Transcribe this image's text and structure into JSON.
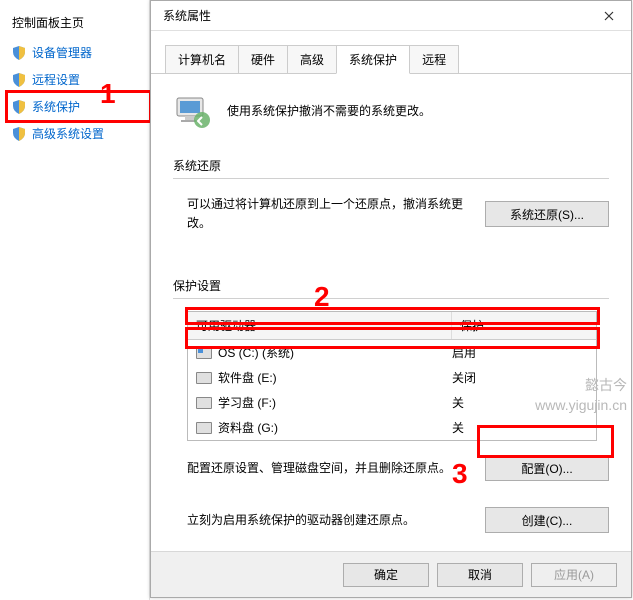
{
  "sidebar": {
    "title": "控制面板主页",
    "items": [
      {
        "label": "设备管理器"
      },
      {
        "label": "远程设置"
      },
      {
        "label": "系统保护"
      },
      {
        "label": "高级系统设置"
      }
    ]
  },
  "dialog": {
    "title": "系统属性",
    "tabs": [
      "计算机名",
      "硬件",
      "高级",
      "系统保护",
      "远程"
    ],
    "active_tab": 3,
    "intro": "使用系统保护撤消不需要的系统更改。",
    "sections": {
      "restore": {
        "header": "系统还原",
        "desc": "可以通过将计算机还原到上一个还原点，撤消系统更改。",
        "button": "系统还原(S)..."
      },
      "protect": {
        "header": "保护设置",
        "columns": {
          "drive": "可用驱动器",
          "status": "保护"
        },
        "drives": [
          {
            "name": "OS (C:) (系统)",
            "status": "启用",
            "os": true
          },
          {
            "name": "软件盘 (E:)",
            "status": "关闭",
            "os": false
          },
          {
            "name": "学习盘 (F:)",
            "status": "关",
            "os": false
          },
          {
            "name": "资料盘 (G:)",
            "status": "关",
            "os": false
          }
        ],
        "config_desc": "配置还原设置、管理磁盘空间，并且删除还原点。",
        "config_button": "配置(O)...",
        "create_desc": "立刻为启用系统保护的驱动器创建还原点。",
        "create_button": "创建(C)..."
      }
    },
    "buttons": {
      "ok": "确定",
      "cancel": "取消",
      "apply": "应用(A)"
    }
  },
  "annotations": {
    "one": "1",
    "two": "2",
    "three": "3"
  },
  "watermark": {
    "line1": "懿古今",
    "line2": "www.yigujin.cn"
  }
}
